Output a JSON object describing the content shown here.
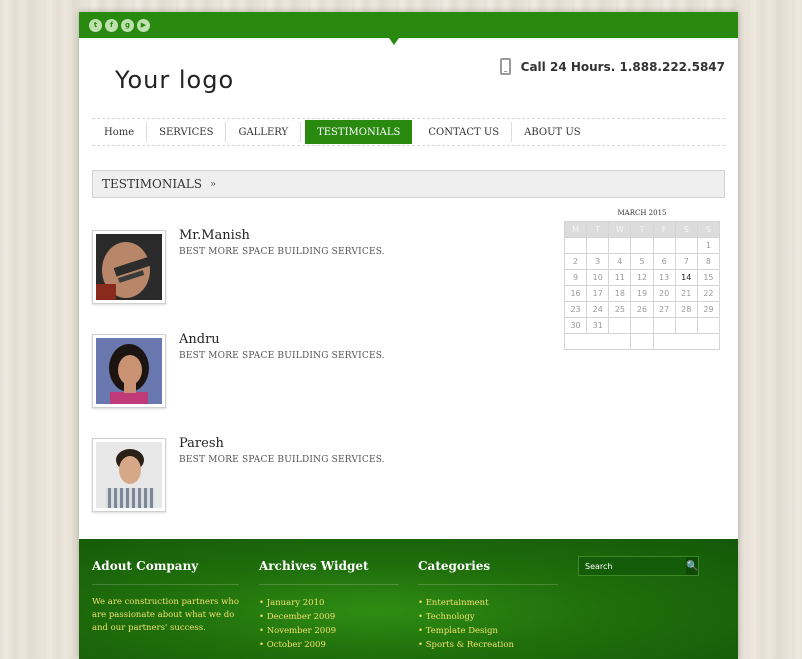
{
  "social": [
    {
      "icon": "twitter-icon",
      "glyph": "t"
    },
    {
      "icon": "facebook-icon",
      "glyph": "f"
    },
    {
      "icon": "google-plus-icon",
      "glyph": "g"
    },
    {
      "icon": "youtube-icon",
      "glyph": "▶"
    }
  ],
  "header": {
    "logo": "Your logo",
    "phone": "Call 24 Hours. 1.888.222.5847"
  },
  "nav": {
    "items": [
      {
        "label": "Home",
        "active": false
      },
      {
        "label": "SERVICES",
        "active": false
      },
      {
        "label": "GALLERY",
        "active": false
      },
      {
        "label": "TESTIMONIALS",
        "active": true
      },
      {
        "label": "CONTACT US",
        "active": false
      },
      {
        "label": "ABOUT US",
        "active": false
      }
    ]
  },
  "breadcrumb": {
    "label": "TESTIMONIALS",
    "sep": "»"
  },
  "testimonials": [
    {
      "name": "Mr.Manish",
      "text": "BEST MORE SPACE BUILDING SERVICES."
    },
    {
      "name": "Andru",
      "text": "BEST MORE SPACE BUILDING SERVICES."
    },
    {
      "name": "Paresh",
      "text": "BEST MORE SPACE BUILDING SERVICES."
    }
  ],
  "calendar": {
    "title": "MARCH 2015",
    "days": [
      "M",
      "T",
      "W",
      "T",
      "F",
      "S",
      "S"
    ],
    "weeks": [
      [
        "",
        "",
        "",
        "",
        "",
        "",
        "1"
      ],
      [
        "2",
        "3",
        "4",
        "5",
        "6",
        "7",
        "8"
      ],
      [
        "9",
        "10",
        "11",
        "12",
        "13",
        "14",
        "15"
      ],
      [
        "16",
        "17",
        "18",
        "19",
        "20",
        "21",
        "22"
      ],
      [
        "23",
        "24",
        "25",
        "26",
        "27",
        "28",
        "29"
      ],
      [
        "30",
        "31",
        "",
        "",
        "",
        "",
        ""
      ]
    ],
    "today": "14"
  },
  "footer": {
    "about": {
      "title": "Adout Company",
      "text": "We are construction partners who are passionate about what we do and our partners' success."
    },
    "archives": {
      "title": "Archives Widget",
      "items": [
        "January 2010",
        "December 2009",
        "November 2009",
        "October 2009"
      ]
    },
    "categories": {
      "title": "Categories",
      "items": [
        "Entertainment",
        "Technology",
        "Template Design",
        "Sports & Recreation"
      ]
    },
    "search": {
      "placeholder": "Search"
    }
  },
  "colors": {
    "brand": "#2a8a10",
    "footer_link": "#f0e070"
  }
}
